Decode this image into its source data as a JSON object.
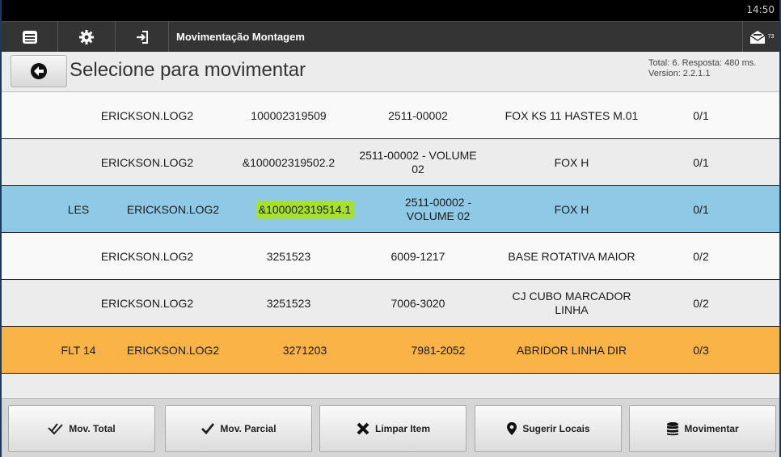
{
  "status_bar": {
    "time": "14:50"
  },
  "action_bar": {
    "title": "Movimentação Montagem",
    "menu_icon": "menu-list-icon",
    "settings_icon": "gear-icon",
    "login_icon": "sign-in-icon",
    "message_icon": "mail-icon",
    "message_count": "73"
  },
  "header": {
    "back_icon": "arrow-left-circle-icon",
    "title": "Selecione para movimentar",
    "total_line": "Total: 6. Resposta: 480 ms.",
    "version_line": "Version: 2.2.1.1"
  },
  "rows": [
    {
      "prefix": "",
      "user": "ERICKSON.LOG2",
      "code": "100002319509",
      "reference": "2511-00002",
      "description": "FOX KS 11 HASTES M.01",
      "qty": "0/1",
      "highlight": false,
      "bg": "#f9f9f9"
    },
    {
      "prefix": "",
      "user": "ERICKSON.LOG2",
      "code": "&100002319502.2",
      "reference": "2511-00002 - VOLUME 02",
      "description": "FOX H",
      "qty": "0/1",
      "highlight": false,
      "bg": "#ececec"
    },
    {
      "prefix": "LES",
      "user": "ERICKSON.LOG2",
      "code": "&100002319514.1",
      "reference": "2511-00002 - VOLUME 02",
      "description": "FOX H",
      "qty": "0/1",
      "highlight": true,
      "bg": "#8ecae6"
    },
    {
      "prefix": "",
      "user": "ERICKSON.LOG2",
      "code": "3251523",
      "reference": "6009-1217",
      "description": "BASE ROTATIVA MAIOR",
      "qty": "0/2",
      "highlight": false,
      "bg": "#f9f9f9"
    },
    {
      "prefix": "",
      "user": "ERICKSON.LOG2",
      "code": "3251523",
      "reference": "7006-3020",
      "description": "CJ CUBO MARCADOR LINHA",
      "qty": "0/2",
      "highlight": false,
      "bg": "#ececec"
    },
    {
      "prefix": "FLT 14",
      "user": "ERICKSON.LOG2",
      "code": "3271203",
      "reference": "7981-2052",
      "description": "ABRIDOR LINHA DIR",
      "qty": "0/3",
      "highlight": false,
      "bg": "#f9b347"
    }
  ],
  "footer": {
    "buttons": [
      {
        "label": "Mov. Total",
        "icon": "double-check-icon"
      },
      {
        "label": "Mov. Parcial",
        "icon": "check-icon"
      },
      {
        "label": "Limpar Item",
        "icon": "x-icon"
      },
      {
        "label": "Sugerir Locais",
        "icon": "map-marker-icon"
      },
      {
        "label": "Movimentar",
        "icon": "database-icon"
      }
    ]
  }
}
